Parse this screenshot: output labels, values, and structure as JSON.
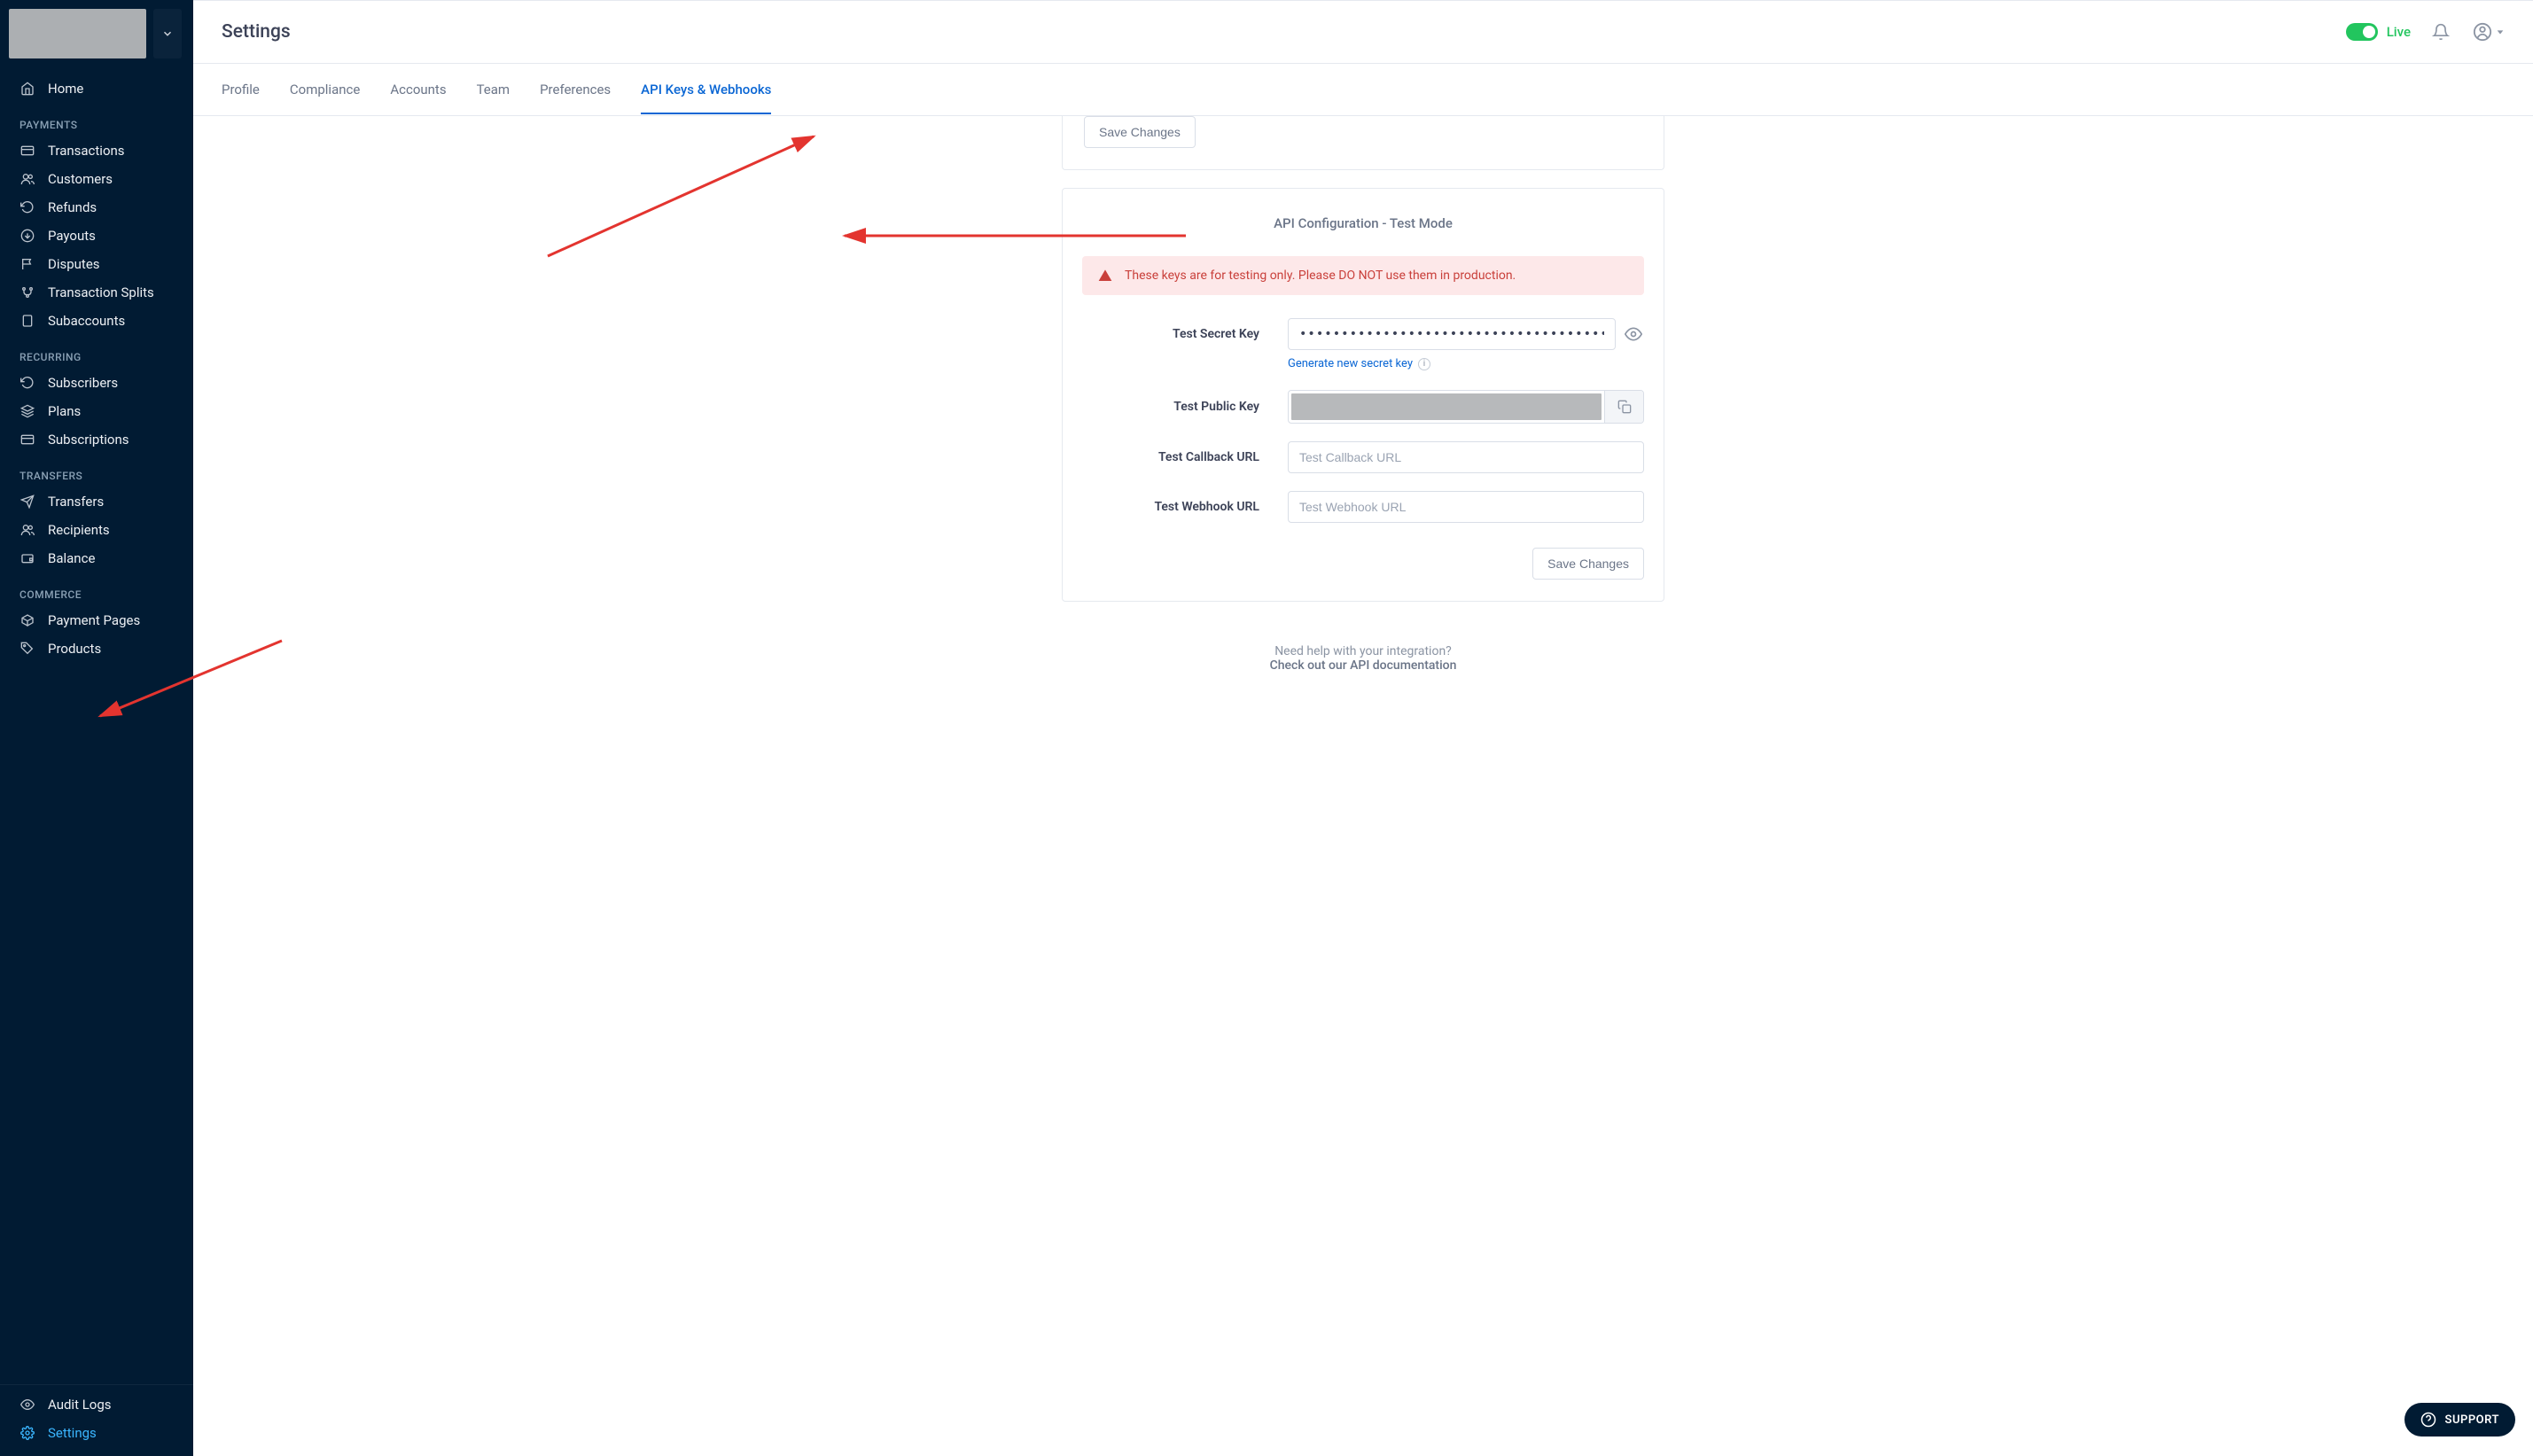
{
  "header": {
    "title": "Settings",
    "mode_label": "Live"
  },
  "tabs": [
    {
      "label": "Profile",
      "active": false
    },
    {
      "label": "Compliance",
      "active": false
    },
    {
      "label": "Accounts",
      "active": false
    },
    {
      "label": "Team",
      "active": false
    },
    {
      "label": "Preferences",
      "active": false
    },
    {
      "label": "API Keys & Webhooks",
      "active": true
    }
  ],
  "top_card": {
    "save_label": "Save Changes"
  },
  "card": {
    "title": "API Configuration - Test Mode",
    "alert": "These keys are for testing only. Please DO NOT use them in production.",
    "rows": {
      "secret": {
        "label": "Test Secret Key",
        "value": "••••••••••••••••••••••••••••••••••••••••••"
      },
      "gen_link": "Generate new secret key",
      "public": {
        "label": "Test Public Key"
      },
      "callback": {
        "label": "Test Callback URL",
        "placeholder": "Test Callback URL"
      },
      "webhook": {
        "label": "Test Webhook URL",
        "placeholder": "Test Webhook URL"
      }
    },
    "save_label": "Save Changes"
  },
  "help": {
    "line1": "Need help with your integration?",
    "line2": "Check out our API documentation"
  },
  "support_label": "SUPPORT",
  "sidebar": {
    "home": "Home",
    "sections": [
      {
        "heading": "PAYMENTS",
        "items": [
          {
            "icon": "card",
            "label": "Transactions"
          },
          {
            "icon": "users",
            "label": "Customers"
          },
          {
            "icon": "undo",
            "label": "Refunds"
          },
          {
            "icon": "down",
            "label": "Payouts"
          },
          {
            "icon": "flag",
            "label": "Disputes"
          },
          {
            "icon": "split",
            "label": "Transaction Splits"
          },
          {
            "icon": "file",
            "label": "Subaccounts"
          }
        ]
      },
      {
        "heading": "RECURRING",
        "items": [
          {
            "icon": "undo",
            "label": "Subscribers"
          },
          {
            "icon": "layers",
            "label": "Plans"
          },
          {
            "icon": "card",
            "label": "Subscriptions"
          }
        ]
      },
      {
        "heading": "TRANSFERS",
        "items": [
          {
            "icon": "send",
            "label": "Transfers"
          },
          {
            "icon": "users",
            "label": "Recipients"
          },
          {
            "icon": "wallet",
            "label": "Balance"
          }
        ]
      },
      {
        "heading": "COMMERCE",
        "items": [
          {
            "icon": "box",
            "label": "Payment Pages"
          },
          {
            "icon": "tag",
            "label": "Products"
          }
        ]
      }
    ],
    "footer": [
      {
        "icon": "eye",
        "label": "Audit Logs",
        "active": false
      },
      {
        "icon": "gear",
        "label": "Settings",
        "active": true
      }
    ]
  }
}
